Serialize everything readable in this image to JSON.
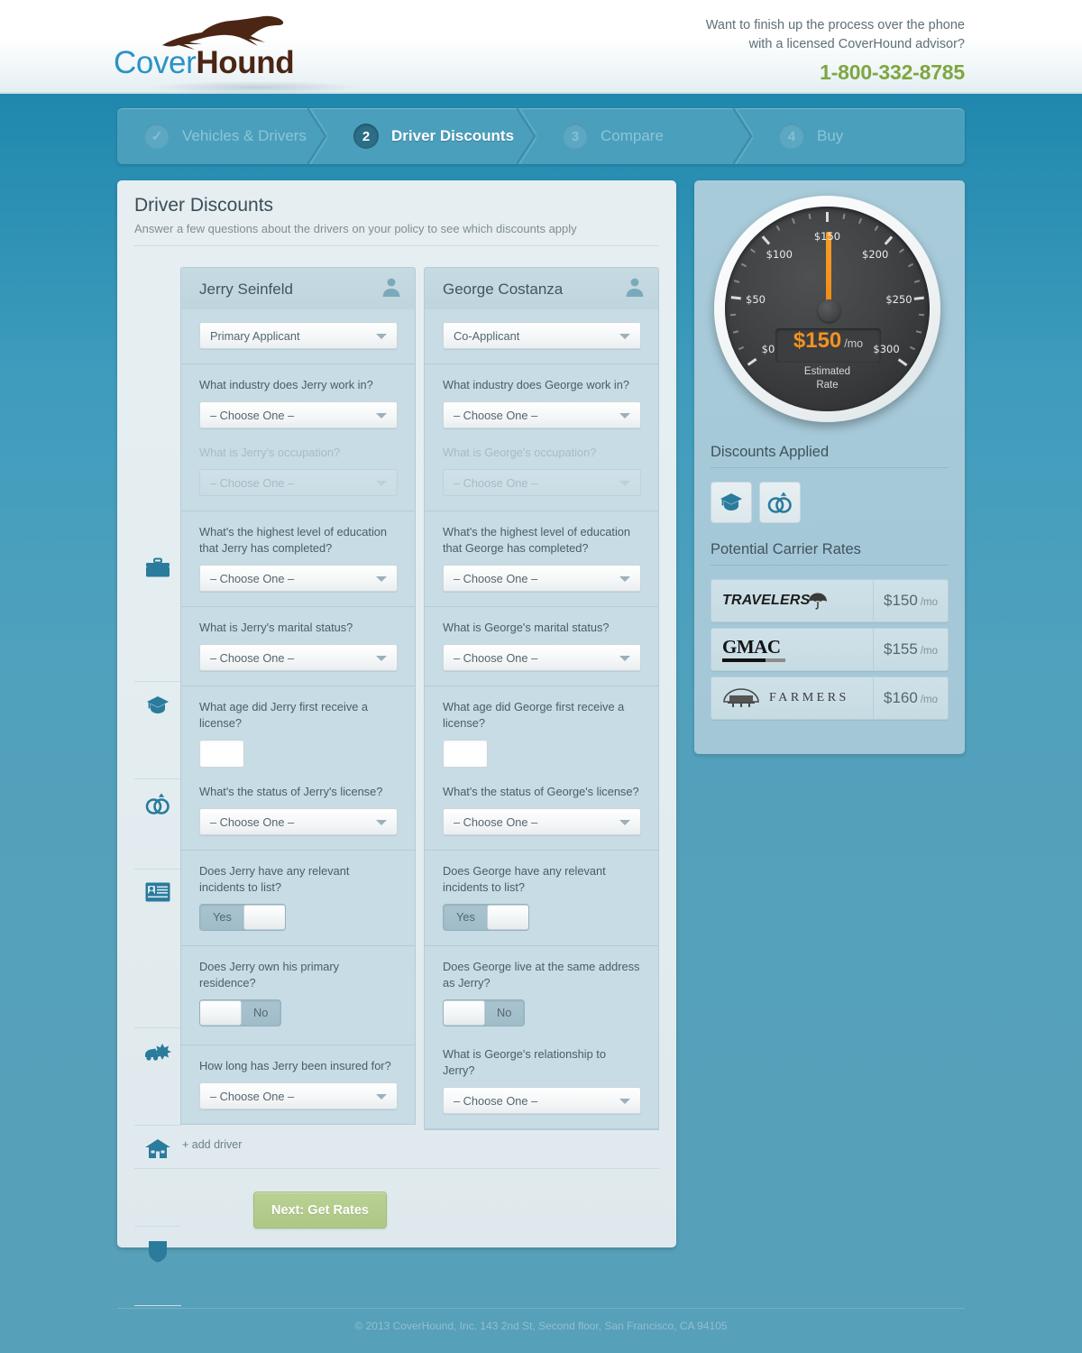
{
  "header": {
    "logo_cover": "Cover",
    "logo_hound": "Hound",
    "logo_icon": "greyhound-icon",
    "promo_line1": "Want to finish up the process over the phone",
    "promo_line2": "with a licensed CoverHound advisor?",
    "phone": "1-800-332-8785",
    "phone_color": "#7fa641"
  },
  "steps": [
    {
      "badge": "✓",
      "label": "Vehicles & Drivers",
      "state": "complete"
    },
    {
      "badge": "2",
      "label": "Driver Discounts",
      "state": "active"
    },
    {
      "badge": "3",
      "label": "Compare",
      "state": "upcoming"
    },
    {
      "badge": "4",
      "label": "Buy",
      "state": "upcoming"
    }
  ],
  "panel": {
    "title": "Driver Discounts",
    "subtitle": "Answer a few questions about the drivers on your policy to see which discounts apply",
    "add_driver": "+ add driver",
    "next_button": "Next: Get Rates",
    "next_button_color": "#b0c98a"
  },
  "drivers": [
    {
      "name": "Jerry Seinfeld",
      "role": "Primary Applicant",
      "avatar_icon": "person-icon"
    },
    {
      "name": "George Costanza",
      "role": "Co-Applicant",
      "avatar_icon": "person-icon"
    }
  ],
  "choose_one": "– Choose One –",
  "rows": [
    {
      "icon": "briefcase-icon",
      "jerry": {
        "q1": "What industry does Jerry work in?",
        "v1": "– Choose One –",
        "q2": "What is Jerry's occupation?",
        "v2": "– Choose One –"
      },
      "george": {
        "q1": "What industry does George work in?",
        "v1": "– Choose One –",
        "q2": "What is George's occupation?",
        "v2": "– Choose One –"
      }
    },
    {
      "icon": "graduation-cap-icon",
      "jerry": {
        "q1": "What's the highest level of education that Jerry has completed?",
        "v1": "– Choose One –"
      },
      "george": {
        "q1": "What's the highest level of education that George has completed?",
        "v1": "– Choose One –"
      }
    },
    {
      "icon": "wedding-rings-icon",
      "jerry": {
        "q1": "What is Jerry's marital status?",
        "v1": "– Choose One –"
      },
      "george": {
        "q1": "What is George's marital status?",
        "v1": "– Choose One –"
      }
    },
    {
      "icon": "id-card-icon",
      "jerry": {
        "q1": "What age did Jerry first receive a license?",
        "v1": "",
        "q2": "What's the status of Jerry's license?",
        "v2": "– Choose One –"
      },
      "george": {
        "q1": "What age did George first receive a license?",
        "v1": "",
        "q2": "What's the status of George's license?",
        "v2": "– Choose One –"
      }
    },
    {
      "icon": "car-crash-icon",
      "jerry": {
        "q1": "Does Jerry have any relevant incidents to list?",
        "toggle": "Yes",
        "toggle_state": "off"
      },
      "george": {
        "q1": "Does George have any relevant incidents to list?",
        "toggle": "Yes",
        "toggle_state": "off"
      }
    },
    {
      "icon": "house-icon",
      "jerry": {
        "q1": "Does Jerry own his primary residence?",
        "toggle": "No",
        "toggle_state": "off"
      },
      "george": {
        "q1": "Does George live at the same address as Jerry?",
        "toggle": "No",
        "toggle_state": "off",
        "q2": "What is George's relationship to Jerry?",
        "v2": "– Choose One –"
      }
    },
    {
      "icon": "shield-icon",
      "jerry": {
        "q1": "How long has Jerry been insured for?",
        "v1": "– Choose One –"
      },
      "george": {}
    }
  ],
  "sidebar": {
    "gauge": {
      "value": "$150",
      "unit": "/mo",
      "caption_line1": "Estimated",
      "caption_line2": "Rate",
      "needle_value": 150,
      "ticks": [
        "$0",
        "$50",
        "$100",
        "$150",
        "$200",
        "$250",
        "$300"
      ],
      "needle_color": "#f29222",
      "face_color": "#3c3e40"
    },
    "discounts_title": "Discounts Applied",
    "discounts": [
      {
        "icon": "graduation-cap-icon",
        "name": "education-discount"
      },
      {
        "icon": "wedding-rings-icon",
        "name": "married-discount"
      }
    ],
    "carriers_title": "Potential Carrier Rates",
    "carriers": [
      {
        "name": "TRAVELERS",
        "logo_icon": "travelers-umbrella-logo",
        "price": "$150",
        "unit": "/mo"
      },
      {
        "name": "GMAC",
        "logo_icon": "gmac-logo",
        "price": "$155",
        "unit": "/mo"
      },
      {
        "name": "FARMERS",
        "logo_icon": "farmers-logo",
        "price": "$160",
        "unit": "/mo"
      }
    ]
  },
  "footer": {
    "copyright": "© 2013 CoverHound, Inc. 143 2nd St, Second floor, San Francisco, CA 94105"
  }
}
